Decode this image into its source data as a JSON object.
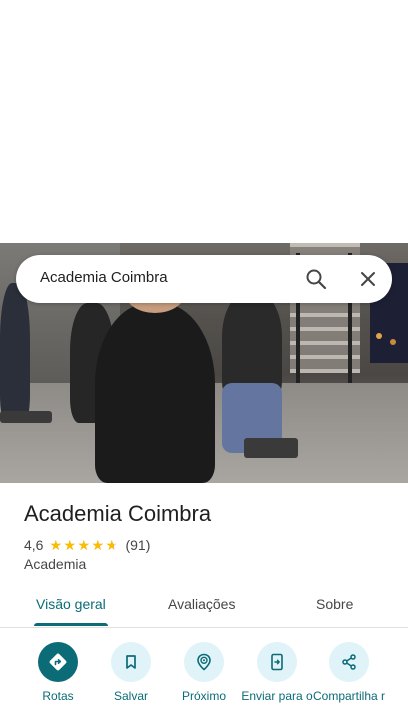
{
  "search": {
    "query": "Academia Coimbra"
  },
  "place": {
    "title": "Academia Coimbra",
    "rating": "4,6",
    "rating_fraction": 0.92,
    "review_count": "(91)",
    "category": "Academia"
  },
  "tabs": [
    {
      "label": "Visão geral",
      "active": true
    },
    {
      "label": "Avaliações",
      "active": false
    },
    {
      "label": "Sobre",
      "active": false
    }
  ],
  "actions": [
    {
      "label": "Rotas",
      "icon": "directions-icon"
    },
    {
      "label": "Salvar",
      "icon": "bookmark-icon"
    },
    {
      "label": "Próximo",
      "icon": "nearby-icon"
    },
    {
      "label": "Enviar para o",
      "icon": "send-to-phone-icon"
    },
    {
      "label": "Compartilha r",
      "icon": "share-icon"
    }
  ],
  "colors": {
    "accent": "#0b6b77",
    "star": "#fbbc04",
    "action_bg": "#dff3f8"
  }
}
